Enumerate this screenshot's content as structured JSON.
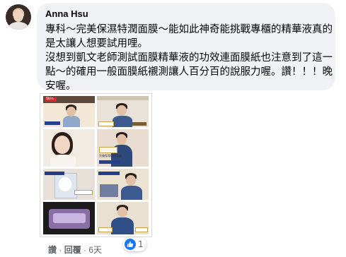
{
  "comment": {
    "author": "Anna Hsu",
    "text": "專科～完美保濕特潤面膜～能如此神奇能挑戰專櫃的精華液真的是太讓人想要試用哩。\n沒想到凱文老師測試面膜精華液的功效連面膜紙也注意到了這一點～的確用一般面膜紙襯測讓人百分百的說服力喔。讚！！！晚安喔。",
    "actions": {
      "like": "讚",
      "separator1": " · ",
      "reply": "回覆",
      "separator2": " · ",
      "time": "6天"
    },
    "reaction_count": "1",
    "colors": {
      "bubble": "#f0f2f5",
      "like_blue": "#1877f2",
      "meta_gray": "#65676b"
    }
  },
  "images": {
    "cell_1_text": "Skin",
    "cell_3_text": "完美保濕特潤面膜"
  }
}
